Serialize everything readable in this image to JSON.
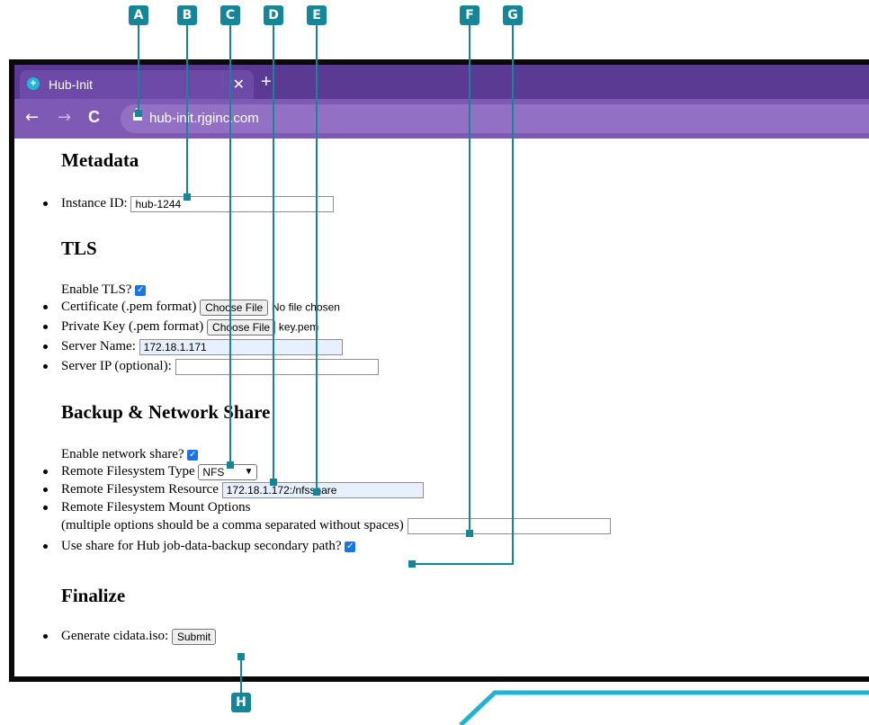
{
  "browser": {
    "tab_title": "Hub-Init",
    "tab_close": "✕",
    "new_tab": "+",
    "back": "←",
    "forward": "→",
    "reload": "C",
    "url": "hub-init.rjginc.com"
  },
  "metadata": {
    "heading": "Metadata",
    "instance_label": "Instance ID:",
    "instance_value": "hub-1244"
  },
  "tls": {
    "heading": "TLS",
    "enable_label": "Enable TLS?",
    "cert_label": "Certificate (.pem format)",
    "cert_button": "Choose File",
    "cert_file": "No file chosen",
    "key_label": "Private Key (.pem format)",
    "key_button": "Choose File",
    "key_file": "key.pem",
    "server_name_label": "Server Name:",
    "server_name_value": "172.18.1.171",
    "server_ip_label": "Server IP (optional):",
    "server_ip_value": ""
  },
  "backup": {
    "heading": "Backup & Network Share",
    "enable_label": "Enable network share?",
    "fs_type_label": "Remote Filesystem Type",
    "fs_type_value": "NFS",
    "resource_label": "Remote Filesystem Resource",
    "resource_value": "172.18.1.172:/nfsshare",
    "mount_label": "Remote Filesystem Mount Options",
    "mount_hint": "(multiple options should be a comma separated without spaces)",
    "mount_value": "",
    "secondary_label": "Use share for Hub job-data-backup secondary path?"
  },
  "finalize": {
    "heading": "Finalize",
    "generate_label": "Generate cidata.iso:",
    "submit": "Submit"
  },
  "callouts": [
    "A",
    "B",
    "C",
    "D",
    "E",
    "F",
    "G",
    "H"
  ],
  "colors": {
    "accent": "#15869a",
    "browser": "#7f5ab5",
    "checkbox": "#1a73e8"
  }
}
